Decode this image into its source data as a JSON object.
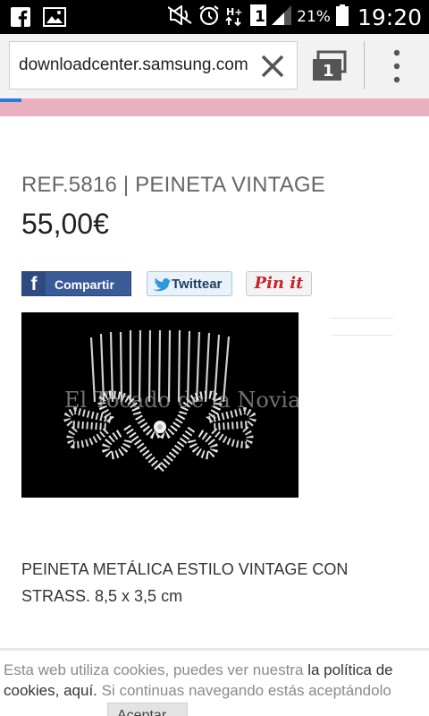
{
  "status_bar": {
    "battery": "21%",
    "time": "19:20",
    "sim_badge": "1"
  },
  "browser": {
    "url": "downloadcenter.samsung.com",
    "tab_count": "1",
    "progress_fraction": 0.05
  },
  "product": {
    "ref_title": "REF.5816 | PEINETA VINTAGE",
    "price": "55,00€",
    "image_watermark": "El Tocado de la Novia",
    "description": "PEINETA METÁLICA ESTILO VINTAGE CON STRASS. 8,5 x 3,5 cm"
  },
  "share": {
    "facebook_label": "Compartir",
    "twitter_label": "Twittear",
    "pinterest_label": "Pin it"
  },
  "cookie": {
    "text_1": "Esta web utiliza cookies, puedes ver nuestra ",
    "link_1": "la política de cookies, aquí.",
    "text_2": " Si continuas navegando estás aceptándolo",
    "accept_label": "Aceptar"
  },
  "colors": {
    "pink_strip": "#ebb0c0",
    "facebook": "#3b5b98",
    "pinterest": "#c8232c",
    "progress": "#2a7bd6"
  },
  "icons": [
    "facebook-icon",
    "image-icon",
    "mute-icon",
    "alarm-icon",
    "data-icon",
    "signal-icon",
    "battery-icon",
    "clear-icon",
    "tabs-icon",
    "overflow-menu-icon",
    "twitter-bird-icon"
  ]
}
